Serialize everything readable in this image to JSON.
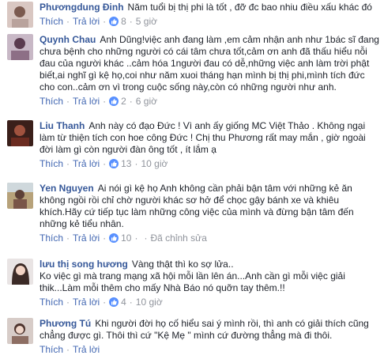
{
  "comments": [
    {
      "author": "Phươngdung Đinh",
      "text": "Năm tuổi bị thị phi là tốt , đỡ đc bao nhiu điều xấu khác đó",
      "like": "Thích",
      "reply": "Trả lời",
      "likes": "8",
      "time": "5 giờ",
      "edited": ""
    },
    {
      "author": "Quynh Chau",
      "text": "Anh Dũng!việc anh đang làm ,em cảm nhận anh như 1bác sĩ đang chưa bệnh cho những người có cái tâm chưa tốt,cảm ơn anh đã thấu hiểu nỗi đau của người khác ..cảm hóa 1người đau có dễ,những việc anh làm trời phật biết,ai nghĩ gì kệ họ,coi như năm xuoi tháng hạn mình bị thị phi,mình tích đức cho con..cảm ơn vì trong cuộc sống này,còn có những người như anh.",
      "like": "Thích",
      "reply": "Trả lời",
      "likes": "2",
      "time": "6 giờ",
      "edited": ""
    },
    {
      "author": "Liu Thanh",
      "text": "Anh này có đạo Đức ! Vì anh ấy giống MC Việt Thảo . Không ngại làm từ thiện tích con hoe công Đức ! Chị thu Phương rất may mắn , giờ ngoài đời làm gì còn người đàn ông tốt , ít lắm ạ",
      "like": "Thích",
      "reply": "Trả lời",
      "likes": "13",
      "time": "10 giờ",
      "edited": ""
    },
    {
      "author": "Yen Nguyen",
      "text": "Ai nói gì kệ họ Anh không cần phải bận tâm với những kẻ ăn không ngồi rồi chỉ chờ người khác sơ hở để chọc gậy bánh xe và khiêu khích.Hãy cứ tiếp tục làm những công việc của mình và đừng bận tâm đến những kẻ tiểu nhân.",
      "like": "Thích",
      "reply": "Trả lời",
      "likes": "10",
      "time": "",
      "edited": "Đã chỉnh sửa"
    },
    {
      "author": "lưu thị song hương",
      "text": "Vàng thật thì ko sợ lửa..\nKo việc gì mà trang mạng xã hội mỗi lần lên án...Anh cần gì mỗi việc giải thik...Làm mỗi thêm cho mấy Nhà Báo nó quỡn tay thêm.!!",
      "like": "Thích",
      "reply": "Trả lời",
      "likes": "4",
      "time": "10 giờ",
      "edited": ""
    },
    {
      "author": "Phương Tú",
      "text": "Khi người đời họ cố hiểu sai ý mình rồi, thì anh có giải thích cũng chẳng được gì. Thôi thì cứ \"Kệ Mẹ \" mình cứ đường thẳng mà đi thôi.",
      "like": "Thích",
      "reply": "Trả lời",
      "likes": "",
      "time": "",
      "edited": ""
    }
  ],
  "colors": {
    "author": "#365899",
    "link": "#4267b2",
    "meta": "#90949c",
    "like_badge": "#5890ff"
  },
  "icons": {
    "like": "thumbs-up-icon"
  }
}
